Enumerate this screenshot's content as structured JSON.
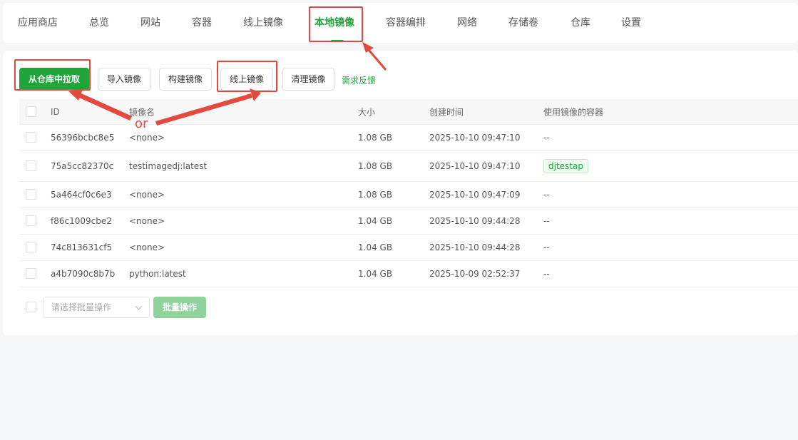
{
  "nav": {
    "items": [
      "应用商店",
      "总览",
      "网站",
      "容器",
      "线上镜像",
      "本地镜像",
      "容器编排",
      "网络",
      "存储卷",
      "仓库",
      "设置"
    ],
    "active": "本地镜像"
  },
  "toolbar": {
    "pull_from_repo": "从仓库中拉取",
    "import_image": "导入镜像",
    "build_image": "构建镜像",
    "online_image": "线上镜像",
    "clean_image": "清理镜像",
    "feedback": "需求反馈"
  },
  "table": {
    "headers": [
      "ID",
      "镜像名",
      "大小",
      "创建时间",
      "使用镜像的容器"
    ],
    "rows": [
      {
        "id": "56396bcbc8e5",
        "name": "<none>",
        "size": "1.08 GB",
        "created": "2025-10-10 09:47:10",
        "containers": "--"
      },
      {
        "id": "75a5cc82370c",
        "name": "testimagedj:latest",
        "size": "1.08 GB",
        "created": "2025-10-10 09:47:10",
        "containers": "djtestap"
      },
      {
        "id": "5a464cf0c6e3",
        "name": "<none>",
        "size": "1.08 GB",
        "created": "2025-10-10 09:47:09",
        "containers": "--"
      },
      {
        "id": "f86c1009cbe2",
        "name": "<none>",
        "size": "1.04 GB",
        "created": "2025-10-10 09:44:28",
        "containers": "--"
      },
      {
        "id": "74c813631cf5",
        "name": "<none>",
        "size": "1.04 GB",
        "created": "2025-10-10 09:44:28",
        "containers": "--"
      },
      {
        "id": "a4b7090c8b7b",
        "name": "python:latest",
        "size": "1.04 GB",
        "created": "2025-10-09 02:52:37",
        "containers": "--"
      }
    ]
  },
  "batch": {
    "select_placeholder": "请选择批量操作",
    "button": "批量操作"
  },
  "annotation": {
    "or_text": "or"
  },
  "colors": {
    "accent": "#20a53a",
    "annotation": "#e5483d"
  }
}
